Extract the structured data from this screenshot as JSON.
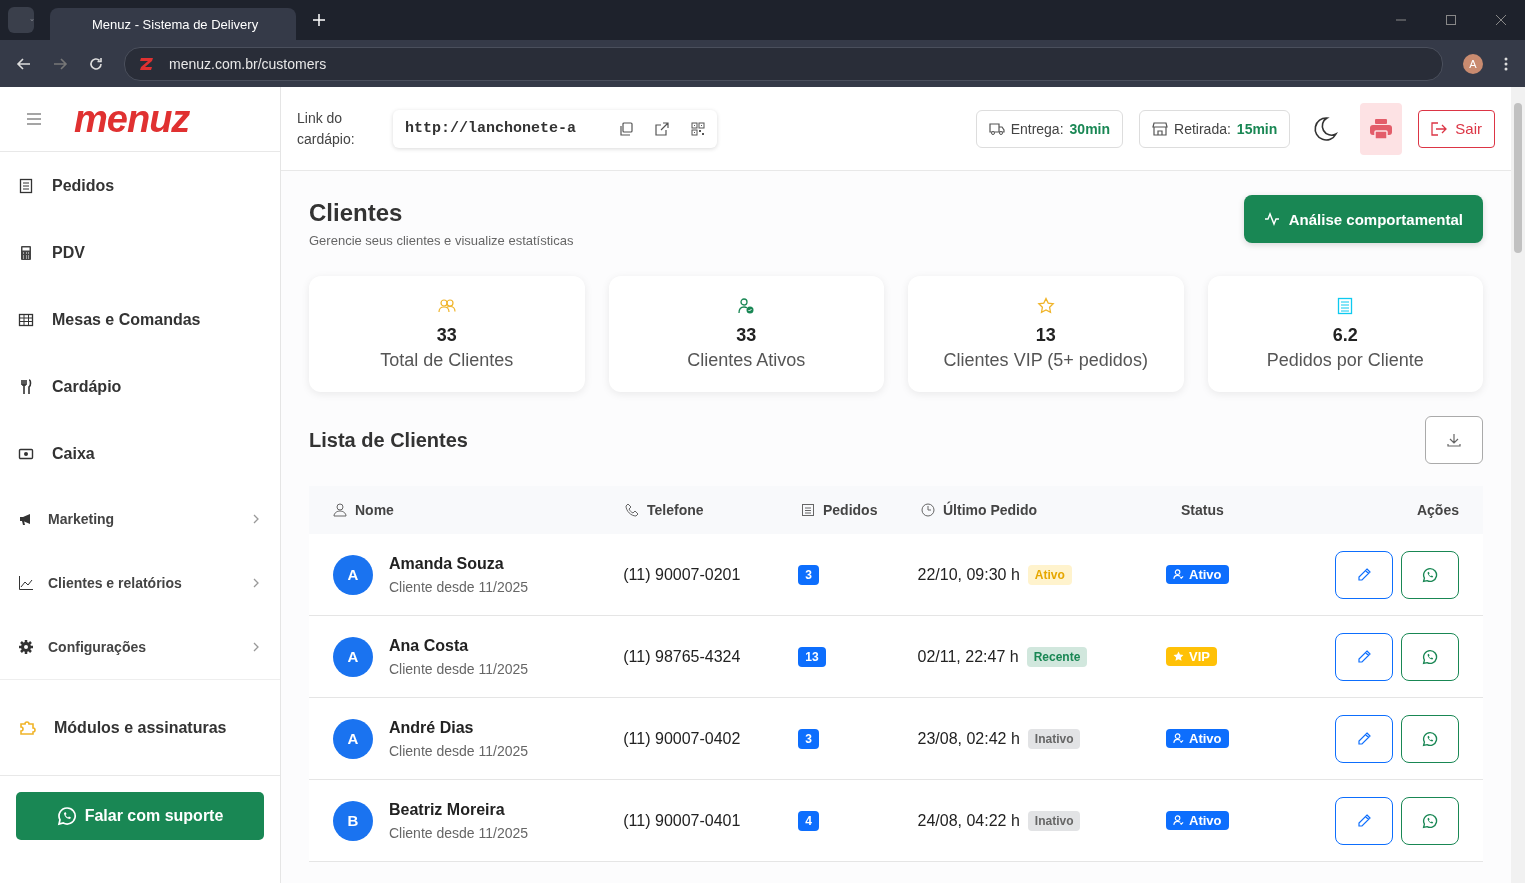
{
  "browser": {
    "tab_title": "Menuz - Sistema de Delivery",
    "url": "menuz.com.br/customers",
    "profile_initial": "A"
  },
  "sidebar": {
    "logo": "menuz",
    "items": [
      {
        "label": "Pedidos",
        "kind": "main"
      },
      {
        "label": "PDV",
        "kind": "main"
      },
      {
        "label": "Mesas e Comandas",
        "kind": "main"
      },
      {
        "label": "Cardápio",
        "kind": "main"
      },
      {
        "label": "Caixa",
        "kind": "main"
      },
      {
        "label": "Marketing",
        "kind": "group"
      },
      {
        "label": "Clientes e relatórios",
        "kind": "group"
      },
      {
        "label": "Configurações",
        "kind": "group"
      }
    ],
    "module_item": "Módulos e assinaturas",
    "support_button": "Falar com suporte"
  },
  "header": {
    "link_label": "Link do cardápio:",
    "link_value": "http://lanchonete-a",
    "delivery": {
      "label": "Entrega:",
      "value": "30min"
    },
    "pickup": {
      "label": "Retirada:",
      "value": "15min"
    },
    "logout": "Sair"
  },
  "page": {
    "title": "Clientes",
    "subtitle": "Gerencie seus clientes e visualize estatísticas",
    "action_button": "Análise comportamental"
  },
  "stats": [
    {
      "value": "33",
      "label": "Total de Clientes"
    },
    {
      "value": "33",
      "label": "Clientes Ativos"
    },
    {
      "value": "13",
      "label": "Clientes VIP (5+ pedidos)"
    },
    {
      "value": "6.2",
      "label": "Pedidos por Cliente"
    }
  ],
  "list": {
    "title": "Lista de Clientes",
    "columns": [
      "Nome",
      "Telefone",
      "Pedidos",
      "Último Pedido",
      "Status",
      "Ações"
    ],
    "rows": [
      {
        "initial": "A",
        "name": "Amanda Souza",
        "since": "Cliente desde 11/2025",
        "phone": "(11) 90007-0201",
        "orders": "3",
        "last_order": "22/10, 09:30 h",
        "recency": {
          "kind": "active",
          "label": "Ativo"
        },
        "status": {
          "kind": "active",
          "label": "Ativo"
        }
      },
      {
        "initial": "A",
        "name": "Ana Costa",
        "since": "Cliente desde 11/2025",
        "phone": "(11) 98765-4324",
        "orders": "13",
        "last_order": "02/11, 22:47 h",
        "recency": {
          "kind": "recent",
          "label": "Recente"
        },
        "status": {
          "kind": "vip",
          "label": "VIP"
        }
      },
      {
        "initial": "A",
        "name": "André Dias",
        "since": "Cliente desde 11/2025",
        "phone": "(11) 90007-0402",
        "orders": "3",
        "last_order": "23/08, 02:42 h",
        "recency": {
          "kind": "inactive",
          "label": "Inativo"
        },
        "status": {
          "kind": "active",
          "label": "Ativo"
        }
      },
      {
        "initial": "B",
        "name": "Beatriz Moreira",
        "since": "Cliente desde 11/2025",
        "phone": "(11) 90007-0401",
        "orders": "4",
        "last_order": "24/08, 04:22 h",
        "recency": {
          "kind": "inactive",
          "label": "Inativo"
        },
        "status": {
          "kind": "active",
          "label": "Ativo"
        }
      }
    ]
  }
}
